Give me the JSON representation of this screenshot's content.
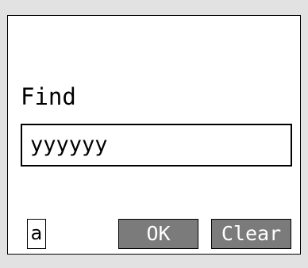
{
  "dialog": {
    "find_label": "Find",
    "search_value": "yyyyyy",
    "a_label": "a",
    "ok_label": "OK",
    "clear_label": "Clear"
  },
  "colors": {
    "frame": "#e2e2e2",
    "button_fill": "#7b7b7b",
    "button_text": "#ffffff",
    "border": "#000000"
  }
}
